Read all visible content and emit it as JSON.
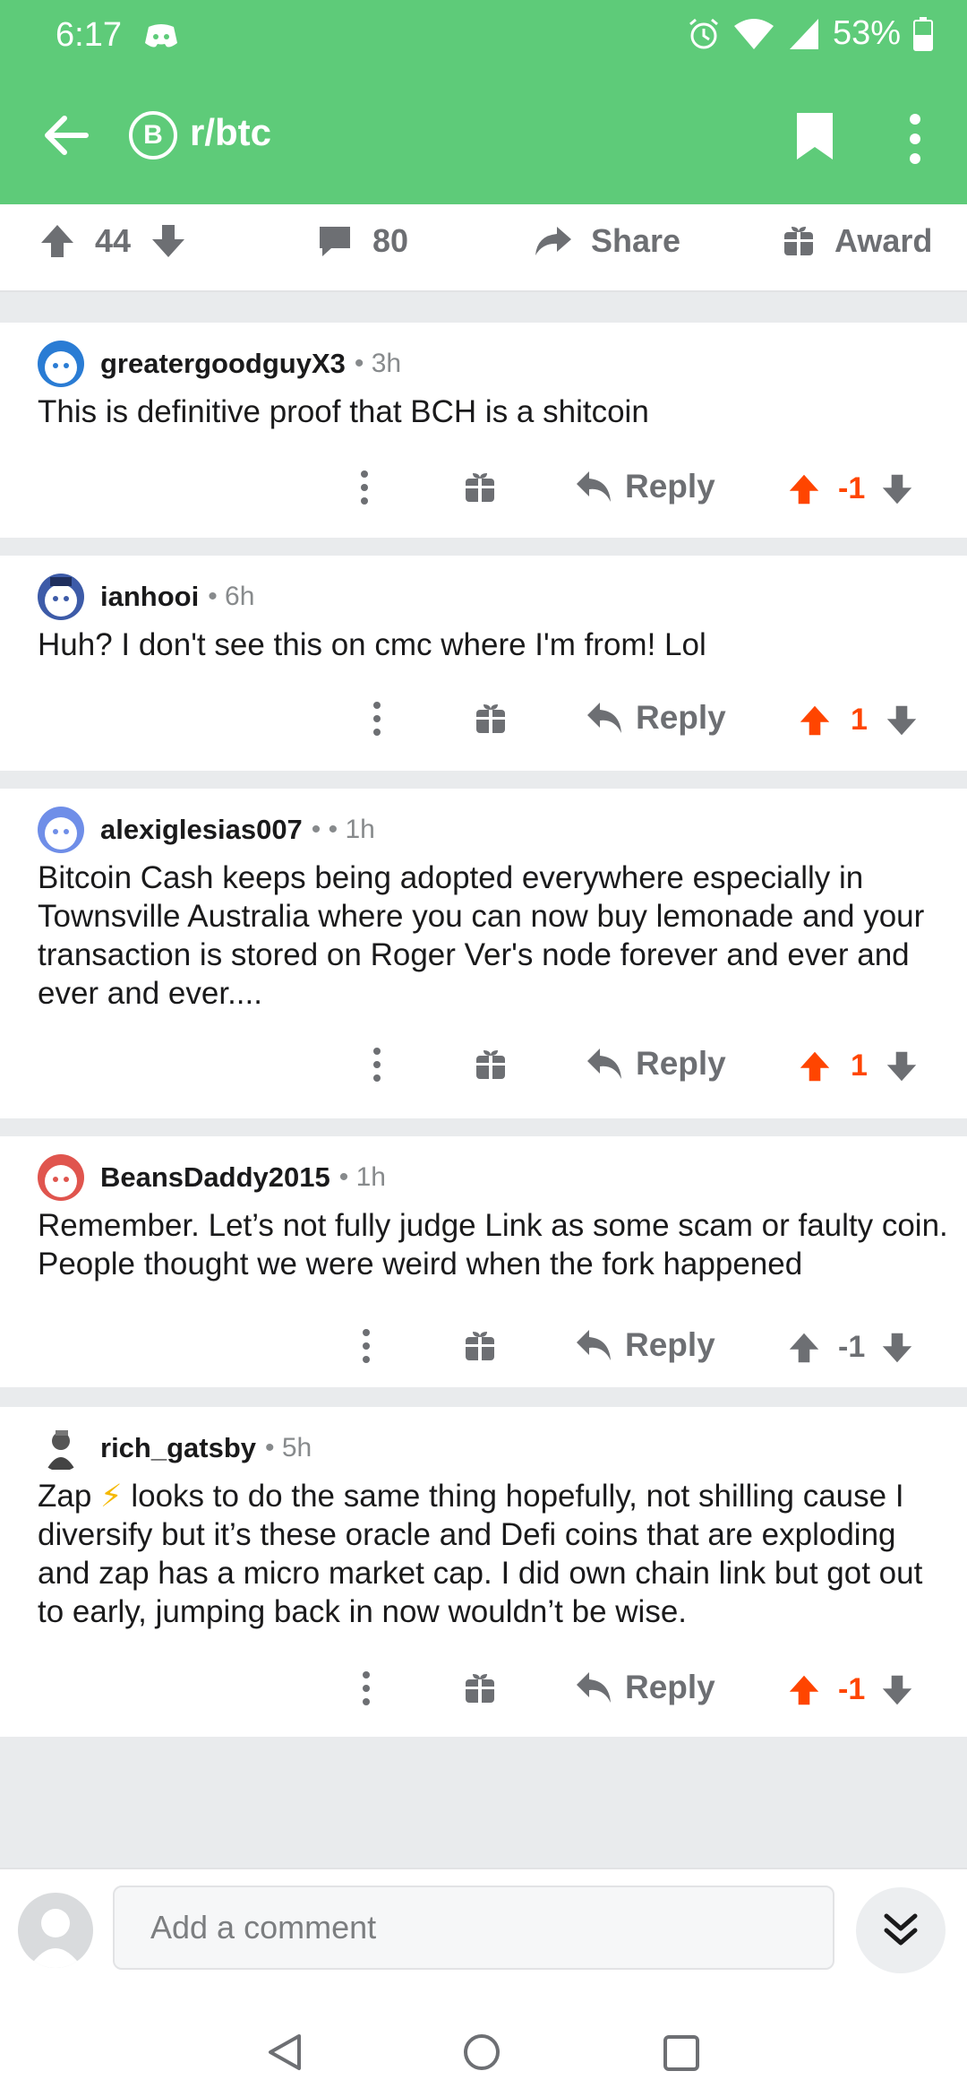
{
  "status_bar": {
    "time": "6:17",
    "battery": "53%"
  },
  "header": {
    "subreddit": "r/btc",
    "coin_symbol": "B",
    "accent": "#5ecb79"
  },
  "post_actions": {
    "votes": "44",
    "comments": "80",
    "share_label": "Share",
    "award_label": "Award"
  },
  "comments": [
    {
      "user": "greatergoodguyX3",
      "meta": "• 3h",
      "body": "This is definitive proof that BCH is a shitcoin",
      "reply_label": "Reply",
      "score": "-1",
      "upvoted": true
    },
    {
      "user": "ianhooi",
      "meta": "• 6h",
      "body": "Huh? I don't see this on cmc where I'm from! Lol",
      "reply_label": "Reply",
      "score": "1",
      "upvoted": true
    },
    {
      "user": "alexiglesias007",
      "meta": "• • 1h",
      "body": "Bitcoin Cash keeps being adopted everywhere especially in Townsville Australia where you can now buy lemonade and your transaction is stored on Roger Ver's node forever and ever and ever and ever....",
      "reply_label": "Reply",
      "score": "1",
      "upvoted": true
    },
    {
      "user": "BeansDaddy2015",
      "meta": "• 1h",
      "body": "Remember.   Let’s not fully judge Link as some scam or faulty coin.   People thought we were weird when the fork happened",
      "reply_label": "Reply",
      "score": "-1",
      "upvoted": false
    },
    {
      "user": "rich_gatsby",
      "meta": "• 5h",
      "body_before": "Zap ",
      "body_emoji": "⚡",
      "body_after": " looks to do the same thing hopefully, not shilling cause I diversify but it’s these oracle and Defi coins that are exploding and zap has a micro market cap. I did own chain link but got out to early, jumping back in now wouldn’t be wise.",
      "reply_label": "Reply",
      "score": "-1",
      "upvoted": true
    }
  ],
  "composer": {
    "placeholder": "Add a comment"
  }
}
